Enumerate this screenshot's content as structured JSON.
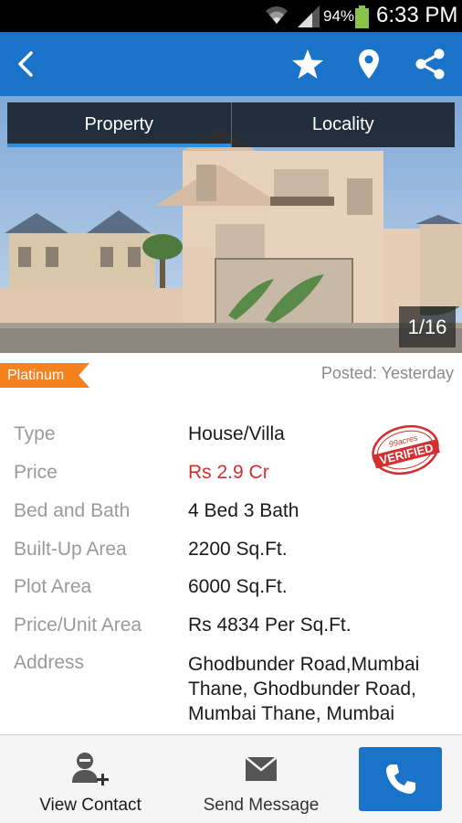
{
  "status_bar": {
    "battery_percent": "94%",
    "time": "6:33 PM",
    "icons": [
      "wifi-icon",
      "signal-icon",
      "battery-icon"
    ]
  },
  "app_bar": {
    "icons": [
      "back-arrow-icon",
      "star-icon",
      "location-pin-icon",
      "share-icon"
    ],
    "color": "#1a73c8"
  },
  "gallery": {
    "tabs": [
      {
        "label": "Property",
        "active": true
      },
      {
        "label": "Locality",
        "active": false
      }
    ],
    "counter": "1/16"
  },
  "listing": {
    "badge": "Platinum",
    "posted": "Posted: Yesterday",
    "verified_stamp_text": [
      "99acres",
      "VERIFIED"
    ],
    "details": [
      {
        "label": "Type",
        "value": "House/Villa"
      },
      {
        "label": "Price",
        "value": "Rs  2.9 Cr"
      },
      {
        "label": "Bed and Bath",
        "value": "4 Bed   3 Bath"
      },
      {
        "label": "Built-Up Area",
        "value": "2200 Sq.Ft."
      },
      {
        "label": "Plot Area",
        "value": "6000 Sq.Ft."
      },
      {
        "label": "Price/Unit Area",
        "value": "Rs 4834 Per Sq.Ft."
      },
      {
        "label": "Address",
        "value": "Ghodbunder Road,Mumbai Thane, Ghodbunder Road, Mumbai Thane, Mumbai"
      }
    ]
  },
  "bottom_bar": {
    "view_contact": "View Contact",
    "send_message": "Send Message",
    "call_icon": "phone-icon"
  },
  "colors": {
    "accent": "#1a73c8",
    "badge": "#f5821f",
    "price": "#d32f2f",
    "stamp": "#d32f2f"
  }
}
